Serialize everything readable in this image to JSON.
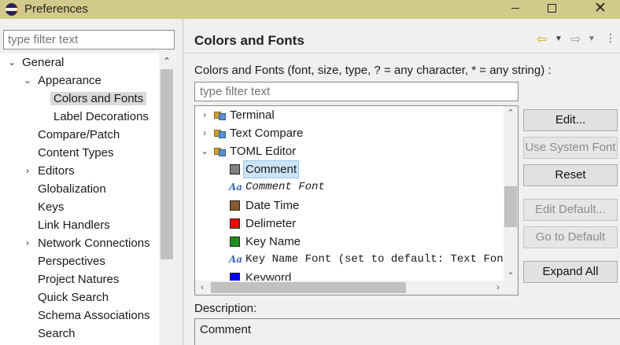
{
  "window": {
    "title": "Preferences"
  },
  "left": {
    "filter_placeholder": "type filter text",
    "tree": [
      {
        "label": "General",
        "expanded": true
      },
      {
        "label": "Appearance",
        "expanded": true
      },
      {
        "label": "Colors and Fonts",
        "selected": true
      },
      {
        "label": "Label Decorations"
      },
      {
        "label": "Compare/Patch"
      },
      {
        "label": "Content Types"
      },
      {
        "label": "Editors",
        "expandable": true
      },
      {
        "label": "Globalization"
      },
      {
        "label": "Keys"
      },
      {
        "label": "Link Handlers"
      },
      {
        "label": "Network Connections",
        "expandable": true
      },
      {
        "label": "Perspectives"
      },
      {
        "label": "Project Natures"
      },
      {
        "label": "Quick Search"
      },
      {
        "label": "Schema Associations"
      },
      {
        "label": "Search"
      }
    ]
  },
  "right": {
    "title": "Colors and Fonts",
    "description_line": "Colors and Fonts (font, size, type, ? = any character, * = any string) :",
    "filter_placeholder": "type filter text",
    "list": [
      {
        "label": "Terminal",
        "kind": "category"
      },
      {
        "label": "Text Compare",
        "kind": "category"
      },
      {
        "label": "TOML Editor",
        "kind": "category"
      },
      {
        "label": "Comment",
        "kind": "color",
        "color": "#808080"
      },
      {
        "label": "Comment Font",
        "kind": "font"
      },
      {
        "label": "Date Time",
        "kind": "color",
        "color": "#8b5a2b"
      },
      {
        "label": "Delimeter",
        "kind": "color",
        "color": "#ff0000"
      },
      {
        "label": "Key Name",
        "kind": "color",
        "color": "#1e8f1e"
      },
      {
        "label": "Key Name Font (set to default: Text Font)",
        "kind": "font"
      },
      {
        "label": "Keyword",
        "kind": "color",
        "color": "#0000ff"
      }
    ],
    "buttons": {
      "edit": "Edit...",
      "use_system_font": "Use System Font",
      "reset": "Reset",
      "edit_default": "Edit Default...",
      "go_to_default": "Go to Default",
      "expand_all": "Expand All"
    },
    "description_label": "Description:",
    "description_value": "Comment"
  }
}
